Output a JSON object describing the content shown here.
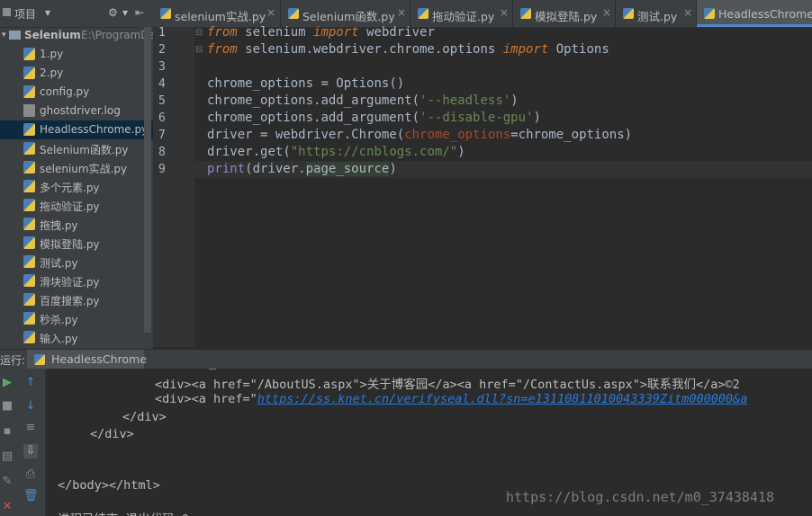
{
  "project_panel": {
    "title": "项目",
    "root_name": "Selenium",
    "root_path": "E:\\ProgramDa",
    "files": [
      {
        "name": "1.py",
        "type": "py"
      },
      {
        "name": "2.py",
        "type": "py"
      },
      {
        "name": "config.py",
        "type": "py"
      },
      {
        "name": "ghostdriver.log",
        "type": "log"
      },
      {
        "name": "HeadlessChrome.py",
        "type": "py",
        "selected": true
      },
      {
        "name": "Selenium函数.py",
        "type": "py"
      },
      {
        "name": "selenium实战.py",
        "type": "py"
      },
      {
        "name": "多个元素.py",
        "type": "py"
      },
      {
        "name": "拖动验证.py",
        "type": "py"
      },
      {
        "name": "拖拽.py",
        "type": "py"
      },
      {
        "name": "模拟登陆.py",
        "type": "py"
      },
      {
        "name": "测试.py",
        "type": "py"
      },
      {
        "name": "滑块验证.py",
        "type": "py"
      },
      {
        "name": "百度搜索.py",
        "type": "py"
      },
      {
        "name": "秒杀.py",
        "type": "py"
      },
      {
        "name": "输入.py",
        "type": "py"
      }
    ]
  },
  "tabs": [
    {
      "label": "selenium实战.py",
      "close": "×"
    },
    {
      "label": "Selenium函数.py",
      "close": "×"
    },
    {
      "label": "拖动验证.py",
      "close": "×"
    },
    {
      "label": "模拟登陆.py",
      "close": "×"
    },
    {
      "label": "测试.py",
      "close": "×"
    },
    {
      "label": "HeadlessChrome",
      "active": true
    }
  ],
  "editor": {
    "line_numbers": [
      "1",
      "2",
      "3",
      "4",
      "5",
      "6",
      "7",
      "8",
      "9"
    ],
    "code": {
      "l1_kw1": "from",
      "l1_mod": " selenium ",
      "l1_kw2": "import",
      "l1_name": " webdriver",
      "l2_kw1": "from",
      "l2_mod": " selenium.webdriver.chrome.options ",
      "l2_kw2": "import",
      "l2_name": " Options",
      "l4_a": "chrome_options ",
      "l4_eq": "=",
      "l4_cls": " Options",
      "l4_p": "()",
      "l5_a": "chrome_options.",
      "l5_fn": "add_argument",
      "l5_p1": "(",
      "l5_s": "'--headless'",
      "l5_p2": ")",
      "l6_a": "chrome_options.",
      "l6_fn": "add_argument",
      "l6_p1": "(",
      "l6_s": "'--disable-gpu'",
      "l6_p2": ")",
      "l7_a": "driver ",
      "l7_eq": "=",
      "l7_b": " webdriver.",
      "l7_fn": "Chrome",
      "l7_p1": "(",
      "l7_pm": "chrome_options",
      "l7_eq2": "=",
      "l7_v": "chrome_options",
      "l7_p2": ")",
      "l8_a": "driver.",
      "l8_fn": "get",
      "l8_p1": "(",
      "l8_s": "\"https://cnblogs.com/\"",
      "l8_p2": ")",
      "l9_fn": "print",
      "l9_p1": "(",
      "l9_a": "driver.",
      "l9_pp": "page_source",
      "l9_p2": ")"
    }
  },
  "run_panel": {
    "label": "运行:",
    "tab_label": "HeadlessChrome",
    "console": {
      "line1_a": "<div><a href=\"/AboutUS.aspx\">关于博客园</a><a href=\"/ContactUs.aspx\">联系我们</a>©2",
      "line2_a": "<div><a href=\"",
      "line2_link": "https://ss.knet.cn/verifyseal.dll?sn=e13110811010043339Zitm000000&a",
      "line3": "</div>",
      "line4": "</div>",
      "line5": "</body></html>",
      "line6": "进程已结束,退出代码 0"
    }
  },
  "watermark": "https://blog.csdn.net/m0_37438418"
}
